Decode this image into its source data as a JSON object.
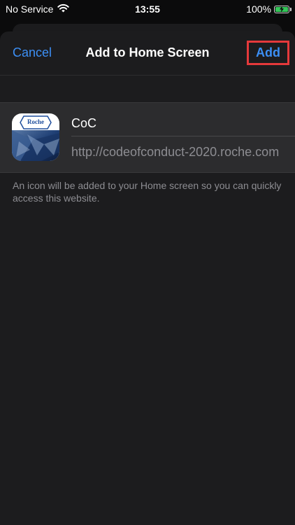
{
  "status_bar": {
    "carrier": "No Service",
    "time": "13:55",
    "battery_percent": "100%",
    "battery_level": 1.0,
    "icons": [
      "wifi-icon",
      "battery-charging-icon"
    ]
  },
  "nav": {
    "cancel_label": "Cancel",
    "title": "Add to Home Screen",
    "add_label": "Add"
  },
  "bookmark": {
    "name": "CoC",
    "url": "http://codeofconduct-2020.roche.com",
    "icon_text": "Roche"
  },
  "footnote": "An icon will be added to your Home screen so you can quickly access this website.",
  "colors": {
    "accent": "#3c8ff5",
    "highlight_box": "#e5393b",
    "battery_green": "#34c759",
    "sheet_bg": "#1c1c1e"
  }
}
